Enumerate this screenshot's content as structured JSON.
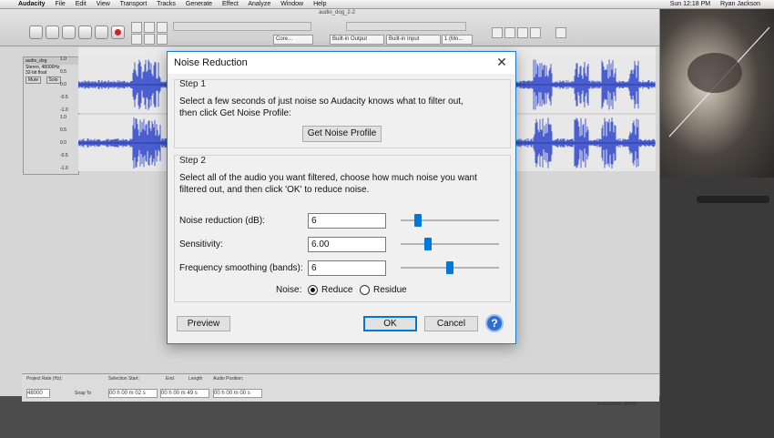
{
  "menubar": {
    "app": "Audacity",
    "items": [
      "File",
      "Edit",
      "View",
      "Transport",
      "Tracks",
      "Generate",
      "Effect",
      "Analyze",
      "Window",
      "Help"
    ],
    "clock": "Sun 12:18 PM",
    "user": "Ryan Jackson"
  },
  "audacity": {
    "project_name": "audio_dog_2-2",
    "toolbar": {
      "output_device": "Built-in Output",
      "input_device": "Built-in Input",
      "channels": "1 (Mo...",
      "host": "Core..."
    },
    "track": {
      "name": "audio_dog",
      "format": "Stereo, 48000Hz",
      "bits": "32-bit float",
      "mute": "Mute",
      "solo": "Solo",
      "scale_top": [
        "1.0",
        "0.5",
        "0.0",
        "-0.5",
        "-1.0"
      ],
      "scale_bottom": [
        "1.0",
        "0.5",
        "0.0",
        "-0.5",
        "-1.0"
      ]
    },
    "project_bar": {
      "rate_label": "Project Rate (Hz):",
      "rate": "48000",
      "snap_label": "Snap To",
      "selection_label": "Selection Start:",
      "end_label": "End",
      "length_label": "Length",
      "position_label": "Audio Position:",
      "start_value": "00 h 00 m 02 s",
      "end_value": "00 h 00 m 49 s",
      "position_value": "00 h 00 m 00 s",
      "actual_rate": "Actual Rate: 48000"
    }
  },
  "dialog": {
    "title": "Noise Reduction",
    "close": "✕",
    "step1": {
      "title": "Step 1",
      "line1": "Select a few seconds of just noise so Audacity knows what to filter out,",
      "line2": "then click Get Noise Profile:",
      "button": "Get Noise Profile"
    },
    "step2": {
      "title": "Step 2",
      "line1": "Select all of the audio you want filtered, choose how much noise you want",
      "line2": "filtered out, and then click 'OK' to reduce noise.",
      "params": [
        {
          "label": "Noise reduction (dB):",
          "value": "6",
          "slider_fraction": 0.15
        },
        {
          "label": "Sensitivity:",
          "value": "6.00",
          "slider_fraction": 0.26
        },
        {
          "label": "Frequency smoothing (bands):",
          "value": "6",
          "slider_fraction": 0.5
        }
      ],
      "noise_label": "Noise:",
      "options": [
        "Reduce",
        "Residue"
      ],
      "selected_option": "Reduce"
    },
    "buttons": {
      "preview": "Preview",
      "ok": "OK",
      "cancel": "Cancel",
      "help": "?"
    }
  },
  "colors": {
    "waveform": "#4a5ed0",
    "accent": "#0078d7",
    "dialog_border": "#1a7dd0"
  }
}
